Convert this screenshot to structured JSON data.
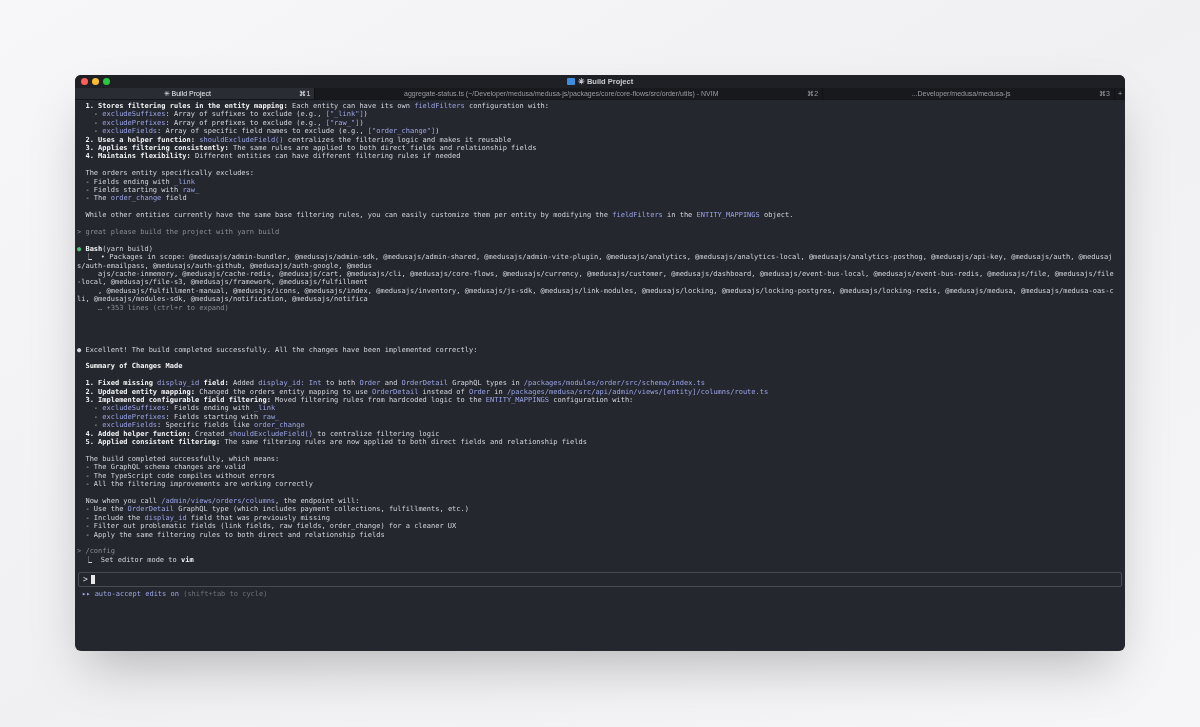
{
  "window": {
    "title": "✳ Build Project"
  },
  "tabs": [
    {
      "label": "✳ Build Project",
      "shortcut": "⌘1",
      "selected": true
    },
    {
      "label": "aggregate-status.ts (~/Developer/medusa/medusa-js/packages/core/core-flows/src/order/utils) - NVIM",
      "shortcut": "⌘2",
      "selected": false
    },
    {
      "label": "...Developer/medusa/medusa-js",
      "shortcut": "⌘3",
      "selected": false
    }
  ],
  "new_tab": "+",
  "lines": [
    {
      "kind": "line",
      "segments": [
        {
          "kind": "bold",
          "text": "  1. Stores filtering rules in the entity mapping:"
        },
        {
          "kind": "plain",
          "text": " Each entity can have its own "
        },
        {
          "kind": "code",
          "text": "fieldFilters"
        },
        {
          "kind": "plain",
          "text": " configuration with:"
        }
      ]
    },
    {
      "kind": "line",
      "segments": [
        {
          "kind": "plain",
          "text": "    - "
        },
        {
          "kind": "code",
          "text": "excludeSuffixes"
        },
        {
          "kind": "plain",
          "text": ": Array of suffixes to exclude (e.g., "
        },
        {
          "kind": "code",
          "text": "[\"_link\"]"
        },
        {
          "kind": "plain",
          "text": ")"
        }
      ]
    },
    {
      "kind": "line",
      "segments": [
        {
          "kind": "plain",
          "text": "    - "
        },
        {
          "kind": "code",
          "text": "excludePrefixes"
        },
        {
          "kind": "plain",
          "text": ": Array of prefixes to exclude (e.g., "
        },
        {
          "kind": "code",
          "text": "[\"raw_\"]"
        },
        {
          "kind": "plain",
          "text": ")"
        }
      ]
    },
    {
      "kind": "line",
      "segments": [
        {
          "kind": "plain",
          "text": "    - "
        },
        {
          "kind": "code",
          "text": "excludeFields"
        },
        {
          "kind": "plain",
          "text": ": Array of specific field names to exclude (e.g., "
        },
        {
          "kind": "code",
          "text": "[\"order_change\"]"
        },
        {
          "kind": "plain",
          "text": ")"
        }
      ]
    },
    {
      "kind": "line",
      "segments": [
        {
          "kind": "bold",
          "text": "  2. Uses a helper function: "
        },
        {
          "kind": "code",
          "text": "shouldExcludeField()"
        },
        {
          "kind": "plain",
          "text": " centralizes the filtering logic and makes it reusable"
        }
      ]
    },
    {
      "kind": "line",
      "segments": [
        {
          "kind": "bold",
          "text": "  3. Applies filtering consistently:"
        },
        {
          "kind": "plain",
          "text": " The same rules are applied to both direct fields and relationship fields"
        }
      ]
    },
    {
      "kind": "line",
      "segments": [
        {
          "kind": "bold",
          "text": "  4. Maintains flexibility:"
        },
        {
          "kind": "plain",
          "text": " Different entities can have different filtering rules if needed"
        }
      ]
    },
    {
      "kind": "blank"
    },
    {
      "kind": "line",
      "segments": [
        {
          "kind": "plain",
          "text": "  The orders entity specifically excludes:"
        }
      ]
    },
    {
      "kind": "line",
      "segments": [
        {
          "kind": "plain",
          "text": "  - Fields ending with "
        },
        {
          "kind": "code",
          "text": "_link"
        }
      ]
    },
    {
      "kind": "line",
      "segments": [
        {
          "kind": "plain",
          "text": "  - Fields starting with "
        },
        {
          "kind": "code",
          "text": "raw_"
        }
      ]
    },
    {
      "kind": "line",
      "segments": [
        {
          "kind": "plain",
          "text": "  - The "
        },
        {
          "kind": "code",
          "text": "order_change"
        },
        {
          "kind": "plain",
          "text": " field"
        }
      ]
    },
    {
      "kind": "blank"
    },
    {
      "kind": "line",
      "segments": [
        {
          "kind": "plain",
          "text": "  While other entities currently have the same base filtering rules, you can easily customize them per entity by modifying the "
        },
        {
          "kind": "code",
          "text": "fieldFilters"
        },
        {
          "kind": "plain",
          "text": " in the "
        },
        {
          "kind": "code",
          "text": "ENTITY_MAPPINGS"
        },
        {
          "kind": "plain",
          "text": " object."
        }
      ]
    },
    {
      "kind": "blank"
    },
    {
      "kind": "line",
      "segments": [
        {
          "kind": "dim",
          "text": "> great please build the project with yarn build"
        }
      ]
    },
    {
      "kind": "blank"
    },
    {
      "kind": "line",
      "segments": [
        {
          "kind": "success",
          "text": "●"
        },
        {
          "kind": "bold",
          "text": " Bash"
        },
        {
          "kind": "plain",
          "text": "(yarn build)"
        }
      ]
    },
    {
      "kind": "line",
      "segments": [
        {
          "kind": "plain",
          "text": "  ⎿  • Packages in scope: @medusajs/admin-bundler, @medusajs/admin-sdk, @medusajs/admin-shared, @medusajs/admin-vite-plugin, @medusajs/analytics, @medusajs/analytics-local, @medusajs/analytics-posthog, @medusajs/api-key, @medusajs/auth, @medusajs/auth-emailpass, @medusajs/auth-github, @medusajs/auth-google, @medus"
        }
      ]
    },
    {
      "kind": "line",
      "segments": [
        {
          "kind": "plain",
          "text": "     ajs/cache-inmemory, @medusajs/cache-redis, @medusajs/cart, @medusajs/cli, @medusajs/core-flows, @medusajs/currency, @medusajs/customer, @medusajs/dashboard, @medusajs/event-bus-local, @medusajs/event-bus-redis, @medusajs/file, @medusajs/file-local, @medusajs/file-s3, @medusajs/framework, @medusajs/fulfillment"
        }
      ]
    },
    {
      "kind": "line",
      "segments": [
        {
          "kind": "plain",
          "text": "     , @medusajs/fulfillment-manual, @medusajs/icons, @medusajs/index, @medusajs/inventory, @medusajs/js-sdk, @medusajs/link-modules, @medusajs/locking, @medusajs/locking-postgres, @medusajs/locking-redis, @medusajs/medusa, @medusajs/medusa-oas-cli, @medusajs/modules-sdk, @medusajs/notification, @medusajs/notifica"
        }
      ]
    },
    {
      "kind": "line",
      "segments": [
        {
          "kind": "dim",
          "text": "     … +353 lines (ctrl+r to expand)"
        }
      ]
    },
    {
      "kind": "blank"
    },
    {
      "kind": "blank"
    },
    {
      "kind": "blank"
    },
    {
      "kind": "blank"
    },
    {
      "kind": "line",
      "segments": [
        {
          "kind": "plain",
          "text": "● Excellent! The build completed successfully. All the changes have been implemented correctly:"
        }
      ]
    },
    {
      "kind": "blank"
    },
    {
      "kind": "line",
      "segments": [
        {
          "kind": "bold",
          "text": "  Summary of Changes Made"
        }
      ]
    },
    {
      "kind": "blank"
    },
    {
      "kind": "line",
      "segments": [
        {
          "kind": "bold",
          "text": "  1. Fixed missing "
        },
        {
          "kind": "code",
          "text": "display_id"
        },
        {
          "kind": "bold",
          "text": " field:"
        },
        {
          "kind": "plain",
          "text": " Added "
        },
        {
          "kind": "code",
          "text": "display_id: Int"
        },
        {
          "kind": "plain",
          "text": " to both "
        },
        {
          "kind": "code",
          "text": "Order"
        },
        {
          "kind": "plain",
          "text": " and "
        },
        {
          "kind": "code",
          "text": "OrderDetail"
        },
        {
          "kind": "plain",
          "text": " GraphQL types in "
        },
        {
          "kind": "code",
          "text": "/packages/modules/order/src/schema/index.ts"
        }
      ]
    },
    {
      "kind": "line",
      "segments": [
        {
          "kind": "bold",
          "text": "  2. Updated entity mapping:"
        },
        {
          "kind": "plain",
          "text": " Changed the orders entity mapping to use "
        },
        {
          "kind": "code",
          "text": "OrderDetail"
        },
        {
          "kind": "plain",
          "text": " instead of "
        },
        {
          "kind": "code",
          "text": "Order"
        },
        {
          "kind": "plain",
          "text": " in "
        },
        {
          "kind": "code",
          "text": "/packages/medusa/src/api/admin/views/[entity]/columns/route.ts"
        }
      ]
    },
    {
      "kind": "line",
      "segments": [
        {
          "kind": "bold",
          "text": "  3. Implemented configurable field filtering:"
        },
        {
          "kind": "plain",
          "text": " Moved filtering rules from hardcoded logic to the "
        },
        {
          "kind": "code",
          "text": "ENTITY_MAPPINGS"
        },
        {
          "kind": "plain",
          "text": " configuration with:"
        }
      ]
    },
    {
      "kind": "line",
      "segments": [
        {
          "kind": "plain",
          "text": "    - "
        },
        {
          "kind": "code",
          "text": "excludeSuffixes"
        },
        {
          "kind": "plain",
          "text": ": Fields ending with "
        },
        {
          "kind": "code",
          "text": "_link"
        }
      ]
    },
    {
      "kind": "line",
      "segments": [
        {
          "kind": "plain",
          "text": "    - "
        },
        {
          "kind": "code",
          "text": "excludePrefixes"
        },
        {
          "kind": "plain",
          "text": ": Fields starting with "
        },
        {
          "kind": "code",
          "text": "raw_"
        }
      ]
    },
    {
      "kind": "line",
      "segments": [
        {
          "kind": "plain",
          "text": "    - "
        },
        {
          "kind": "code",
          "text": "excludeFields"
        },
        {
          "kind": "plain",
          "text": ": Specific fields like "
        },
        {
          "kind": "code",
          "text": "order_change"
        }
      ]
    },
    {
      "kind": "line",
      "segments": [
        {
          "kind": "bold",
          "text": "  4. Added helper function:"
        },
        {
          "kind": "plain",
          "text": " Created "
        },
        {
          "kind": "code",
          "text": "shouldExcludeField()"
        },
        {
          "kind": "plain",
          "text": " to centralize filtering logic"
        }
      ]
    },
    {
      "kind": "line",
      "segments": [
        {
          "kind": "bold",
          "text": "  5. Applied consistent filtering:"
        },
        {
          "kind": "plain",
          "text": " The same filtering rules are now applied to both direct fields and relationship fields"
        }
      ]
    },
    {
      "kind": "blank"
    },
    {
      "kind": "line",
      "segments": [
        {
          "kind": "plain",
          "text": "  The build completed successfully, which means:"
        }
      ]
    },
    {
      "kind": "line",
      "segments": [
        {
          "kind": "plain",
          "text": "  - The GraphQL schema changes are valid"
        }
      ]
    },
    {
      "kind": "line",
      "segments": [
        {
          "kind": "plain",
          "text": "  - The TypeScript code compiles without errors"
        }
      ]
    },
    {
      "kind": "line",
      "segments": [
        {
          "kind": "plain",
          "text": "  - All the filtering improvements are working correctly"
        }
      ]
    },
    {
      "kind": "blank"
    },
    {
      "kind": "line",
      "segments": [
        {
          "kind": "plain",
          "text": "  Now when you call "
        },
        {
          "kind": "code",
          "text": "/admin/views/orders/columns"
        },
        {
          "kind": "plain",
          "text": ", the endpoint will:"
        }
      ]
    },
    {
      "kind": "line",
      "segments": [
        {
          "kind": "plain",
          "text": "  - Use the "
        },
        {
          "kind": "code",
          "text": "OrderDetail"
        },
        {
          "kind": "plain",
          "text": " GraphQL type (which includes payment collections, fulfillments, etc.)"
        }
      ]
    },
    {
      "kind": "line",
      "segments": [
        {
          "kind": "plain",
          "text": "  - Include the "
        },
        {
          "kind": "code",
          "text": "display_id"
        },
        {
          "kind": "plain",
          "text": " field that was previously missing"
        }
      ]
    },
    {
      "kind": "line",
      "segments": [
        {
          "kind": "plain",
          "text": "  - Filter out problematic fields (link fields, raw fields, order_change) for a cleaner UX"
        }
      ]
    },
    {
      "kind": "line",
      "segments": [
        {
          "kind": "plain",
          "text": "  - Apply the same filtering rules to both direct and relationship fields"
        }
      ]
    },
    {
      "kind": "blank"
    },
    {
      "kind": "line",
      "segments": [
        {
          "kind": "dim",
          "text": "> /config"
        }
      ]
    },
    {
      "kind": "line",
      "segments": [
        {
          "kind": "plain",
          "text": "  ⎿  Set editor mode to "
        },
        {
          "kind": "bold",
          "text": "vim"
        }
      ]
    }
  ],
  "input": {
    "prompt": ">"
  },
  "mode": {
    "arrows": "▸▸",
    "label": "auto-accept edits on",
    "hint": "(shift+tab to cycle)"
  }
}
